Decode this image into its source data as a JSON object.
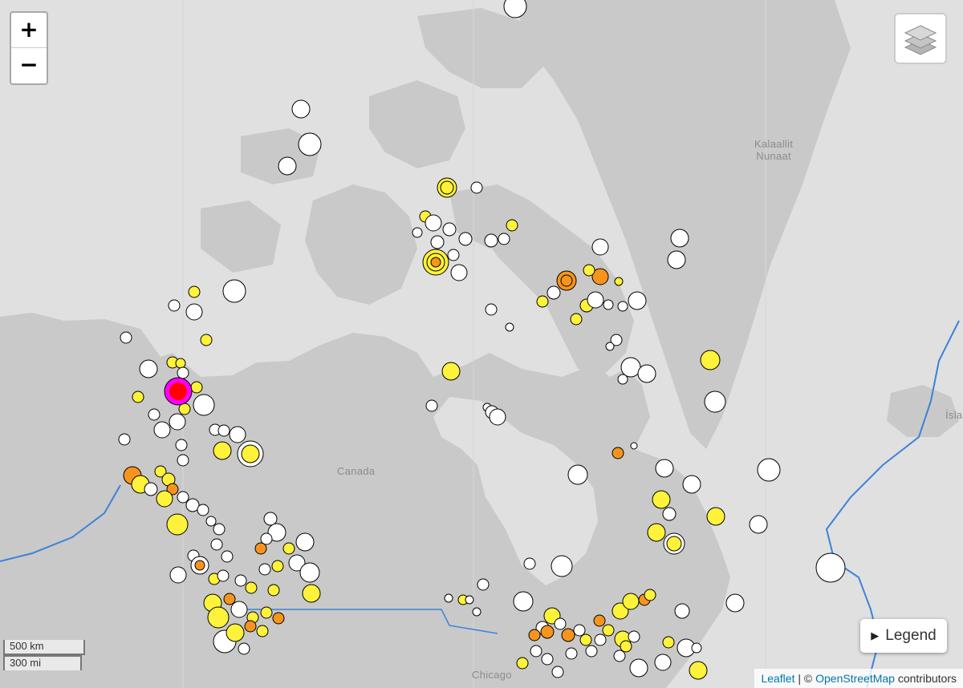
{
  "map": {
    "labels": {
      "canada": "Canada",
      "greenland": "Kalaallit\nNunaat",
      "iceland": "Ísland",
      "chicago": "Chicago"
    },
    "colors": {
      "ocean": "#e0e0e0",
      "land": "#c9c9c9",
      "border": "#3b82d9",
      "marker_white": "#ffffff",
      "marker_yellow": "#fff23a",
      "marker_orange": "#f7941d",
      "marker_red": "#ff0000",
      "marker_magenta": "#ff00ff",
      "marker_stroke": "#000000"
    }
  },
  "controls": {
    "zoom_in": "+",
    "zoom_out": "−",
    "layers_icon": "layers-icon",
    "legend_label": "Legend",
    "legend_icon": "▶"
  },
  "scale": {
    "km": "500 km",
    "mi": "300 mi"
  },
  "attribution": {
    "leaflet": "Leaflet",
    "sep": " | © ",
    "osm": "OpenStreetMap",
    "suffix": " contributors"
  }
}
